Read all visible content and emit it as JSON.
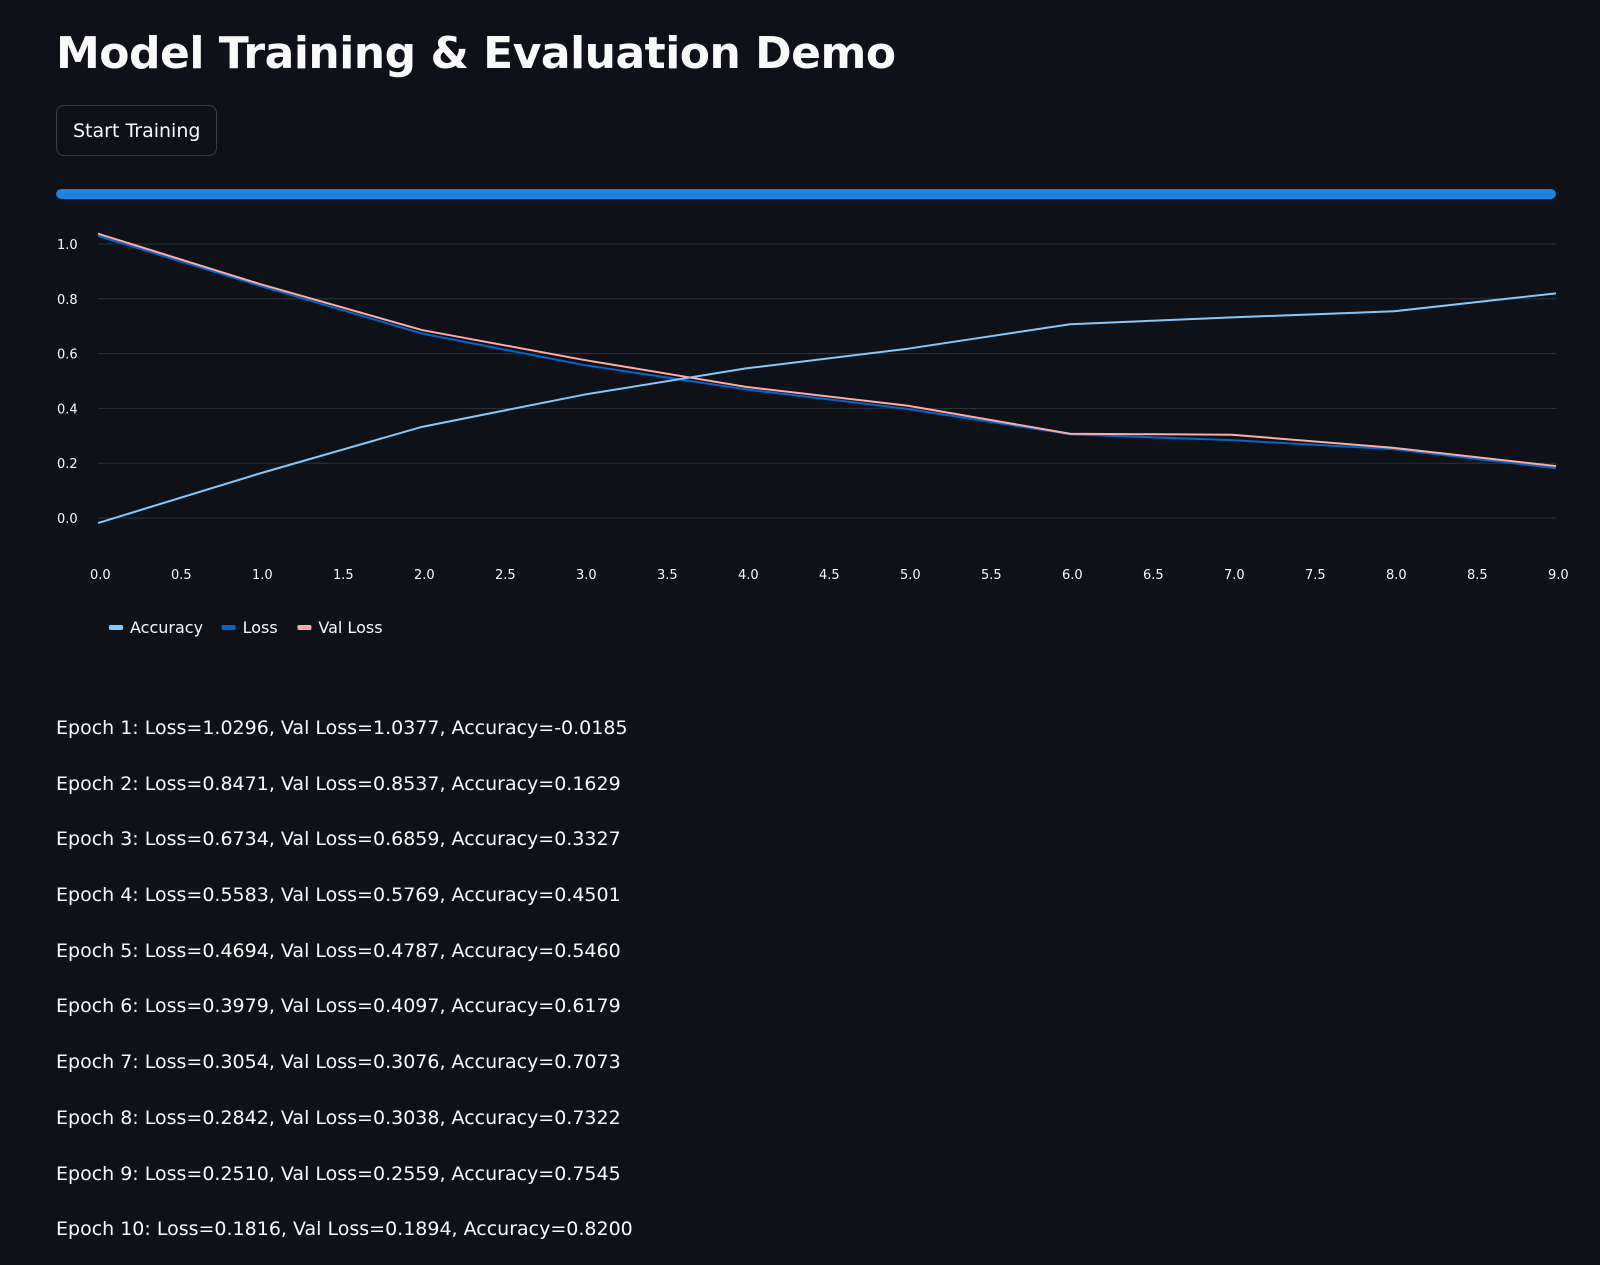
{
  "app": {
    "title": "Model Training & Evaluation Demo",
    "start_button_label": "Start Training"
  },
  "progress": {
    "value": 1.0,
    "color": "#1c83e1"
  },
  "colors": {
    "background": "#0e1117",
    "text": "#fafafa",
    "grid": "#2f323b"
  },
  "chart_data": {
    "type": "line",
    "x": [
      0,
      1,
      2,
      3,
      4,
      5,
      6,
      7,
      8,
      9
    ],
    "xlim": [
      0,
      9
    ],
    "ylim": [
      -0.1,
      1.1
    ],
    "x_ticks": [
      "0.0",
      "0.5",
      "1.0",
      "1.5",
      "2.0",
      "2.5",
      "3.0",
      "3.5",
      "4.0",
      "4.5",
      "5.0",
      "5.5",
      "6.0",
      "6.5",
      "7.0",
      "7.5",
      "8.0",
      "8.5",
      "9.0"
    ],
    "y_ticks": [
      "1.0",
      "0.8",
      "0.6",
      "0.4",
      "0.2",
      "0.0"
    ],
    "grid": "horizontal",
    "legend_position": "bottom-left",
    "series": [
      {
        "name": "Accuracy",
        "color": "#83c9ff",
        "values": [
          -0.0185,
          0.1629,
          0.3327,
          0.4501,
          0.546,
          0.6179,
          0.7073,
          0.7322,
          0.7545,
          0.82
        ]
      },
      {
        "name": "Loss",
        "color": "#0068c9",
        "values": [
          1.0296,
          0.8471,
          0.6734,
          0.5583,
          0.4694,
          0.3979,
          0.3054,
          0.2842,
          0.251,
          0.1816
        ]
      },
      {
        "name": "Val Loss",
        "color": "#ffabab",
        "values": [
          1.0377,
          0.8537,
          0.6859,
          0.5769,
          0.4787,
          0.4097,
          0.3076,
          0.3038,
          0.2559,
          0.1894
        ]
      }
    ]
  },
  "logs": [
    "Epoch 1: Loss=1.0296, Val Loss=1.0377, Accuracy=-0.0185",
    "Epoch 2: Loss=0.8471, Val Loss=0.8537, Accuracy=0.1629",
    "Epoch 3: Loss=0.6734, Val Loss=0.6859, Accuracy=0.3327",
    "Epoch 4: Loss=0.5583, Val Loss=0.5769, Accuracy=0.4501",
    "Epoch 5: Loss=0.4694, Val Loss=0.4787, Accuracy=0.5460",
    "Epoch 6: Loss=0.3979, Val Loss=0.4097, Accuracy=0.6179",
    "Epoch 7: Loss=0.3054, Val Loss=0.3076, Accuracy=0.7073",
    "Epoch 8: Loss=0.2842, Val Loss=0.3038, Accuracy=0.7322",
    "Epoch 9: Loss=0.2510, Val Loss=0.2559, Accuracy=0.7545",
    "Epoch 10: Loss=0.1816, Val Loss=0.1894, Accuracy=0.8200"
  ]
}
